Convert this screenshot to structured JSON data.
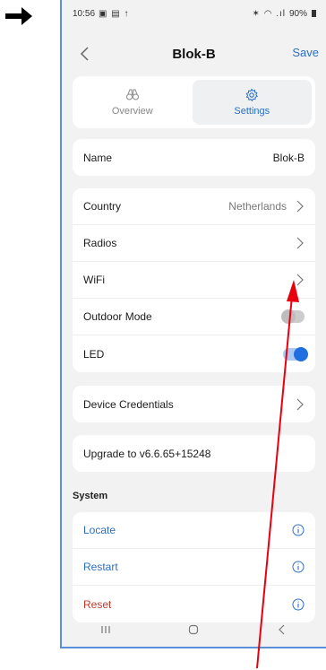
{
  "status_bar": {
    "time": "10:56",
    "left_icons": "▣ ▤ ↑",
    "right_icons": "✶ ◠ .ıl",
    "battery": "90%"
  },
  "nav": {
    "title": "Blok-B",
    "save_label": "Save"
  },
  "tabs": [
    {
      "label": "Overview",
      "selected": false,
      "icon": "binoculars-icon"
    },
    {
      "label": "Settings",
      "selected": true,
      "icon": "gear-icon"
    }
  ],
  "name_card": {
    "label": "Name",
    "value": "Blok-B"
  },
  "settings_card": {
    "country": {
      "label": "Country",
      "value": "Netherlands"
    },
    "radios": {
      "label": "Radios"
    },
    "wifi": {
      "label": "WiFi"
    },
    "outdoor_mode": {
      "label": "Outdoor Mode",
      "on": false
    },
    "led": {
      "label": "LED",
      "on": true
    }
  },
  "credentials_card": {
    "label": "Device Credentials"
  },
  "upgrade_card": {
    "label": "Upgrade to v6.6.65+15248"
  },
  "system": {
    "heading": "System",
    "actions": [
      {
        "label": "Locate"
      },
      {
        "label": "Restart"
      },
      {
        "label": "Reset"
      }
    ]
  },
  "colors": {
    "accent": "#2c6fc1",
    "danger": "#c0392b",
    "toggle_on": "#1f6fe0",
    "annotation": "#e8000f",
    "frame": "#5b8fd9"
  }
}
